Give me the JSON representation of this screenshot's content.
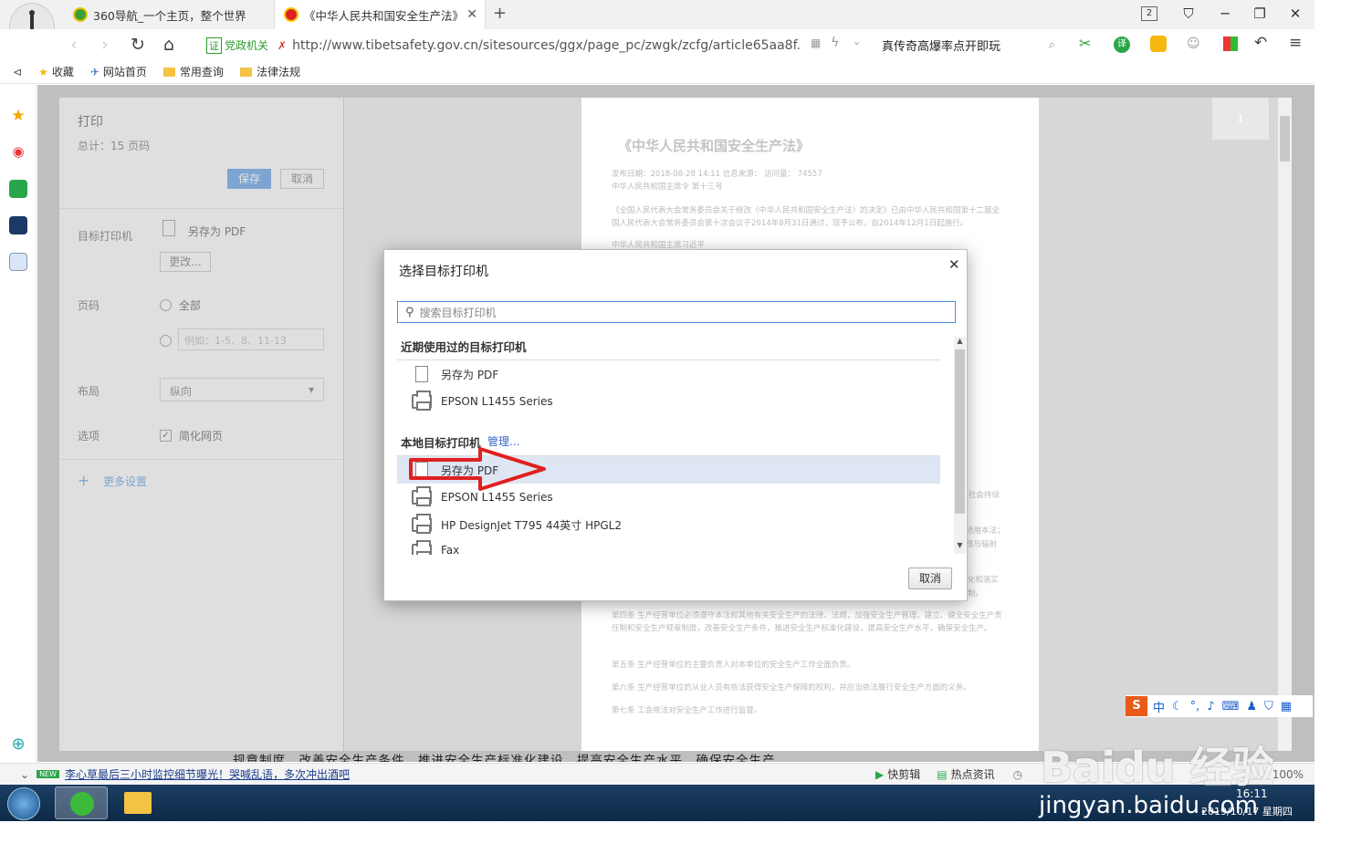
{
  "tabs": [
    {
      "label": "360导航_一个主页，整个世界"
    },
    {
      "label": "《中华人民共和国安全生产法》"
    }
  ],
  "tab_count": "2",
  "address": {
    "badge": "证",
    "cert_label": "党政机关",
    "url": "http://www.tibetsafety.gov.cn/sitesources/ggx/page_pc/zwgk/zcfg/article65aa8f."
  },
  "search_hint": "真传奇高爆率点开即玩",
  "bookmarks": [
    "收藏",
    "网站首页",
    "常用查询",
    "法律法规"
  ],
  "print_panel": {
    "title": "打印",
    "total": "总计：15 页码",
    "save": "保存",
    "cancel": "取消",
    "dest_label": "目标打印机",
    "dest_value": "另存为 PDF",
    "change": "更改...",
    "pages_label": "页码",
    "pages_all": "全部",
    "pages_placeholder": "例如：1-5、8、11-13",
    "layout_label": "布局",
    "layout_value": "纵向",
    "options_label": "选项",
    "options_value": "简化网页",
    "more": "更多设置"
  },
  "preview": {
    "page_number": "1",
    "doc_title": "《中华人民共和国安全生产法》",
    "meta": "发布日期：2018-08-28 14:11  信息来源：  访问量：  74557",
    "meta2": "中华人民共和国主席令  第十三号",
    "para1": "《全国人民代表大会常务委员会关于修改〈中华人民共和国安全生产法〉的决定》已由中华人民共和国第十二届全国人民代表大会常务委员会第十次会议于2014年8月31日通过，现予公布，自2014年12月1日起施行。",
    "para2": "中华人民共和国主席习近平",
    "para3": "第四条 生产经营单位必须遵守本法和其他有关安全生产的法律、法规，加强安全生产管理，建立、健全安全生产责任制和安全生产规章制度，改善安全生产条件，推进安全生产标准化建设，提高安全生产水平，确保安全生产。",
    "para4": "第五条 生产经营单位的主要负责人对本单位的安全生产工作全面负责。",
    "para5": "第六条 生产经营单位的从业人员有依法获得安全生产保障的权利，并应当依法履行安全生产方面的义务。",
    "para6": "第七条 工会依法对安全生产工作进行监督。",
    "frag1": "社会持续",
    "frag2": "适用本法；",
    "frag3": "核与辐射",
    "frag4": "化和落实",
    "frag5": "制。",
    "bottom_text": "规章制度，改善安全生产条件，推进安全生产标准化建设，提高安全生产水平，确保安全生产。"
  },
  "dialog": {
    "title": "选择目标打印机",
    "search_placeholder": "搜索目标打印机",
    "recent_header": "近期使用过的目标打印机",
    "recent": [
      {
        "label": "另存为 PDF",
        "icon": "pdf"
      },
      {
        "label": "EPSON L1455 Series",
        "icon": "printer"
      }
    ],
    "local_header": "本地目标打印机",
    "manage": "管理...",
    "local": [
      {
        "label": "另存为 PDF",
        "icon": "pdf",
        "selected": true
      },
      {
        "label": "EPSON L1455 Series",
        "icon": "printer"
      },
      {
        "label": "HP DesignJet T795 44英寸 HPGL2",
        "icon": "printer"
      },
      {
        "label": "Fax",
        "icon": "printer"
      }
    ],
    "cancel": "取消"
  },
  "status": {
    "news_badge": "NEW",
    "news": "李心草最后三小时监控细节曝光！哭喊乱语，多次冲出酒吧",
    "edit": "快剪辑",
    "hot": "热点资讯",
    "zoom": "100%"
  },
  "ime": {
    "lang": "中"
  },
  "taskbar": {
    "time": "16:11",
    "date": "2019/10/17 星期四"
  },
  "watermark": {
    "brand": "Baidu 经验",
    "url": "jingyan.baidu.com"
  },
  "colors": {
    "accent": "#4a90e2",
    "arrow": "#e02020",
    "selected_row": "#dfe6f3"
  }
}
